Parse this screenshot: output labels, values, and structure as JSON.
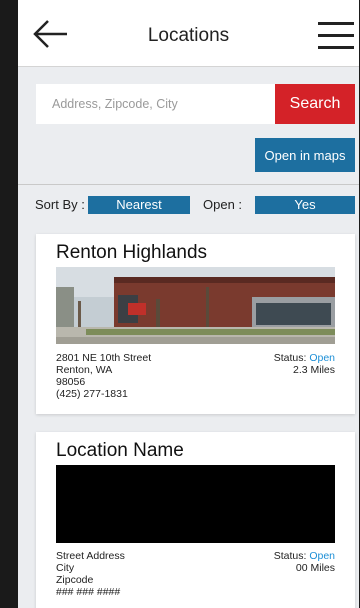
{
  "header": {
    "title": "Locations"
  },
  "search": {
    "placeholder": "Address, Zipcode, City",
    "button_label": "Search"
  },
  "maps_button_label": "Open in maps",
  "filters": {
    "sort_label": "Sort By :",
    "sort_value": "Nearest",
    "open_label": "Open :",
    "open_value": "Yes"
  },
  "locations": [
    {
      "name": "Renton Highlands",
      "address_line1": "2801 NE 10th Street",
      "address_line2": "Renton, WA",
      "zipcode": "98056",
      "phone": "(425) 277-1831",
      "status_label": "Status:",
      "status_value": "Open",
      "distance": "2.3 Miles",
      "image": "library-building-photo"
    },
    {
      "name": "Location Name",
      "address_line1": "Street Address",
      "address_line2": "City",
      "zipcode": "Zipcode",
      "phone": "### ### ####",
      "status_label": "Status:",
      "status_value": "Open",
      "distance": "00 Miles",
      "image": "placeholder-black"
    }
  ],
  "colors": {
    "accent_blue": "#1d6fa0",
    "search_red": "#d42228",
    "open_blue": "#1d8fd6"
  }
}
